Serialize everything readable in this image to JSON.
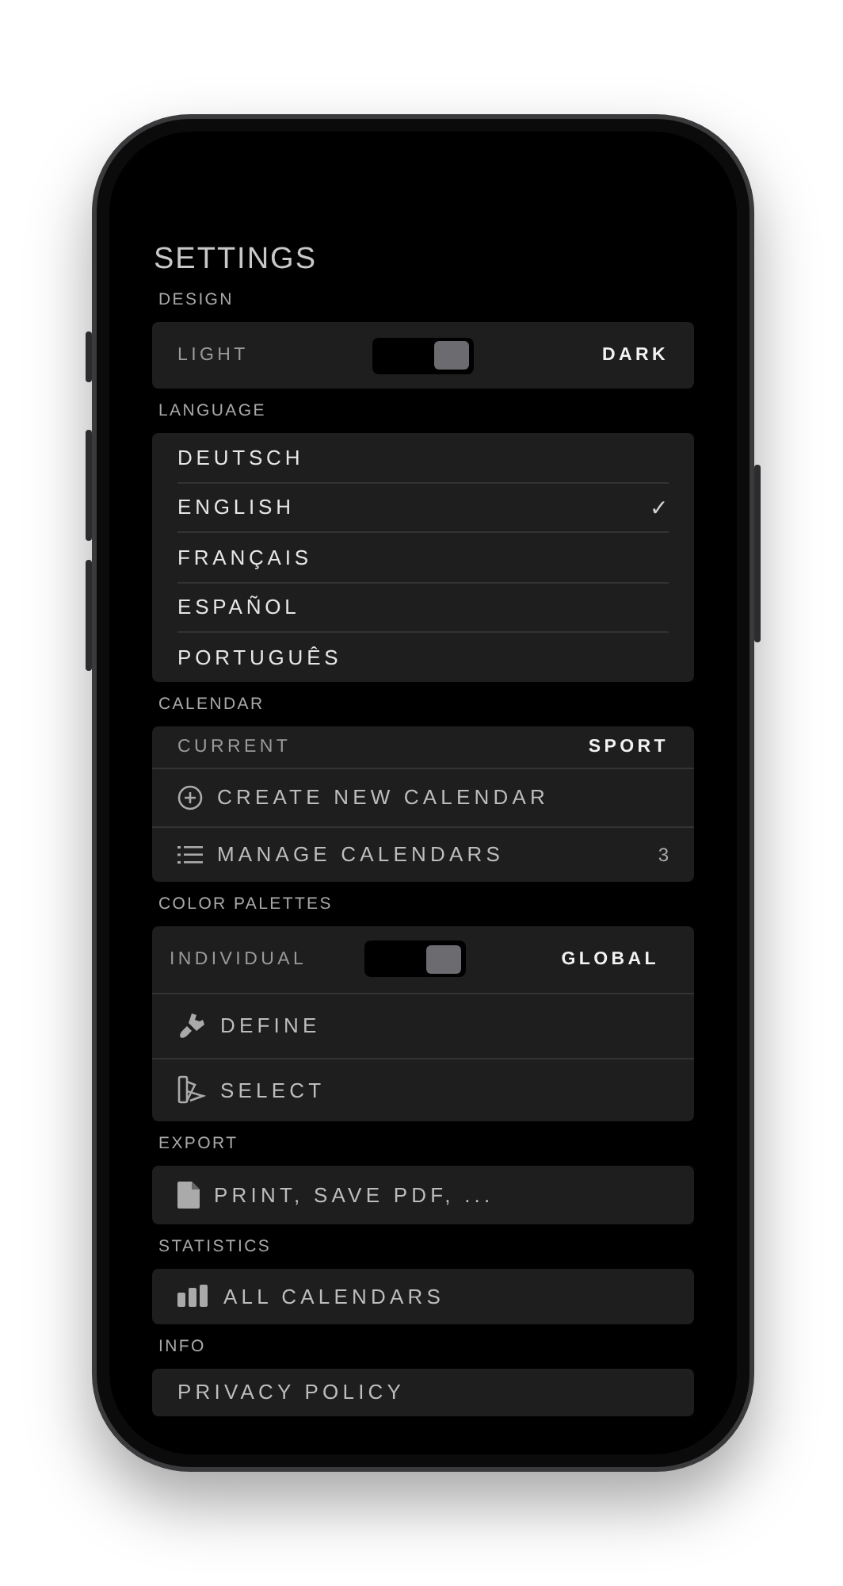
{
  "title": "SETTINGS",
  "design": {
    "label": "DESIGN",
    "left": "LIGHT",
    "right": "DARK",
    "on": true
  },
  "language": {
    "label": "LANGUAGE",
    "check_mark": "✓",
    "items": [
      {
        "name": "DEUTSCH",
        "selected": false
      },
      {
        "name": "ENGLISH",
        "selected": true
      },
      {
        "name": "FRANÇAIS",
        "selected": false
      },
      {
        "name": "ESPAÑOL",
        "selected": false
      },
      {
        "name": "PORTUGUÊS",
        "selected": false
      }
    ]
  },
  "calendar": {
    "label": "CALENDAR",
    "current_label": "CURRENT",
    "current_value": "SPORT",
    "create": "CREATE NEW CALENDAR",
    "manage": "MANAGE CALENDARS",
    "manage_count": "3"
  },
  "color_palettes": {
    "label": "COLOR PALETTES",
    "left": "INDIVIDUAL",
    "right": "GLOBAL",
    "on": true,
    "define": "DEFINE",
    "select": "SELECT"
  },
  "export": {
    "label": "EXPORT",
    "item": "PRINT, SAVE PDF, ..."
  },
  "statistics": {
    "label": "STATISTICS",
    "item": "ALL CALENDARS"
  },
  "info": {
    "label": "INFO",
    "item": "PRIVACY POLICY"
  }
}
